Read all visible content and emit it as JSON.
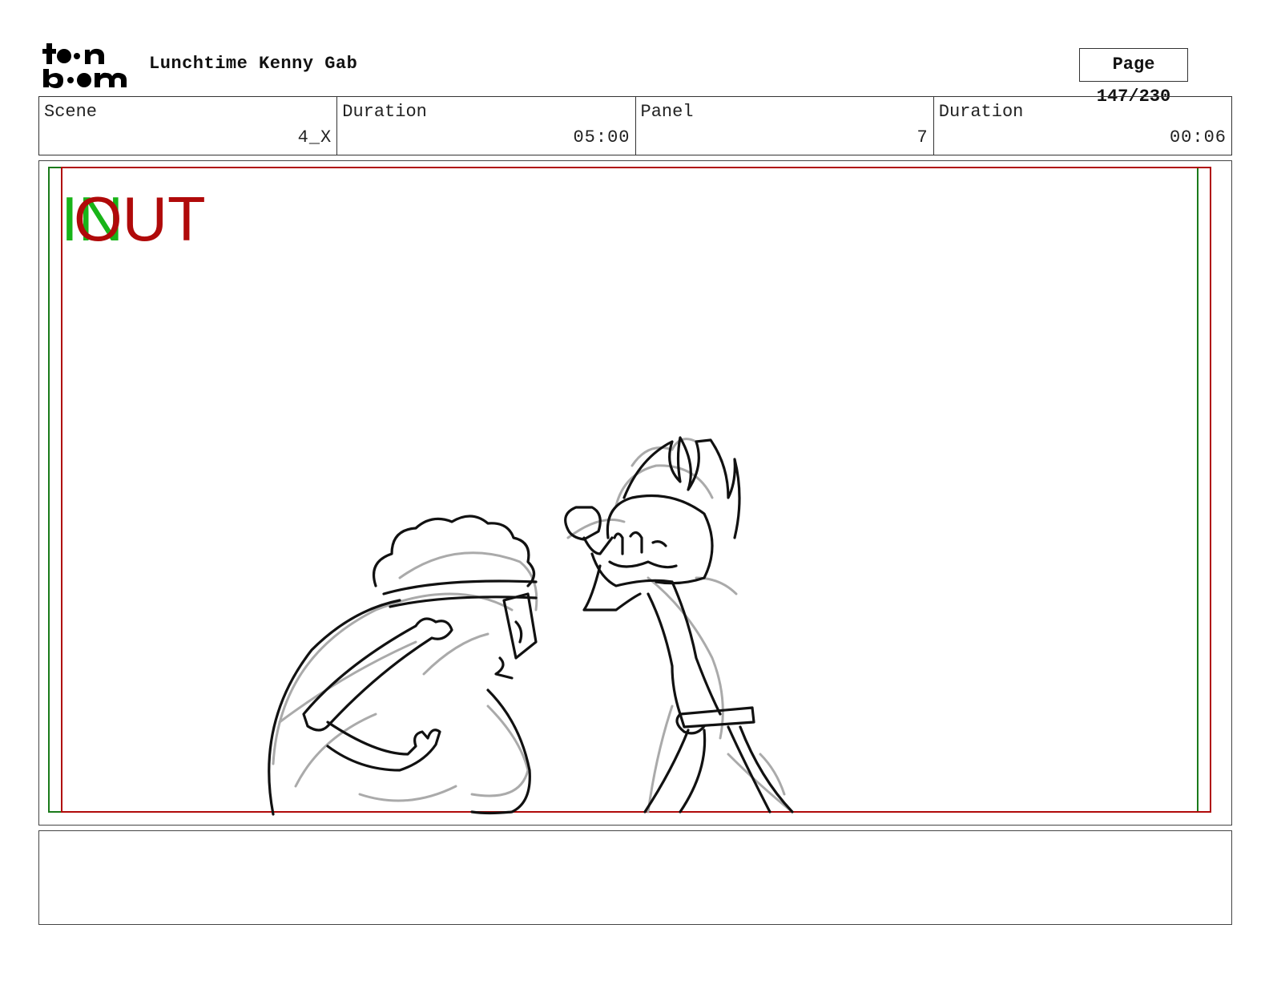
{
  "header": {
    "logo_text": "toon boom",
    "title": "Lunchtime Kenny Gab",
    "page_label": "Page 147/230"
  },
  "info": {
    "scene_label": "Scene",
    "scene_value": "4_X",
    "duration_label": "Duration",
    "duration_value": "05:00",
    "panel_label": "Panel",
    "panel_value": "7",
    "panel_duration_label": "Duration",
    "panel_duration_value": "00:06"
  },
  "panel": {
    "in_marker": "IN",
    "out_marker": "OUT",
    "in_color": "#18b418",
    "out_color": "#b00a0a",
    "sketch_description_icon": "storyboard-sketch"
  },
  "notes": {
    "text": ""
  }
}
